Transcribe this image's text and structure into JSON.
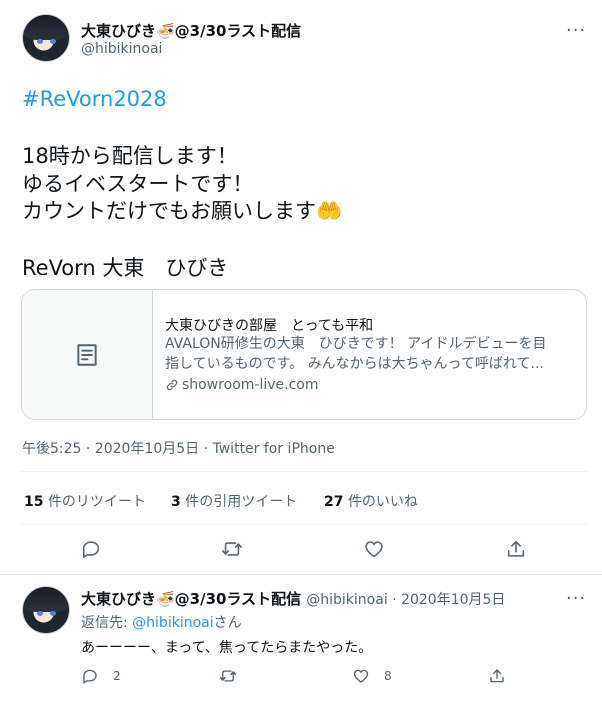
{
  "main_tweet": {
    "display_name": "大東ひびき🍜@3/30ラスト配信",
    "handle": "@hibikinoai",
    "more": "···",
    "hashtag": "#ReVorn2028",
    "lines": [
      "18時から配信します！",
      "ゆるイベスタートです！",
      "カウントだけでもお願いします🤲",
      "ReVorn 大東　ひびき"
    ],
    "card": {
      "title": "大東ひびきの部屋　とっても平和",
      "description_line1": "AVALON研修生の大東　ひびきです！ アイドルデビューを目",
      "description_line2": "指しているものです。 みんなからは大ちゃんって呼ばれて...",
      "domain": "showroom-live.com",
      "thumbnail_icon": "document-icon",
      "link_icon": "link-icon"
    },
    "meta": "午後5:25 · 2020年10月5日 · Twitter for iPhone",
    "stats": {
      "retweets_count": "15",
      "retweets_label": "件のリツイート",
      "quotes_count": "3",
      "quotes_label": "件の引用ツイート",
      "likes_count": "27",
      "likes_label": "件のいいね"
    },
    "actions": [
      "reply-icon",
      "retweet-icon",
      "like-icon",
      "share-icon"
    ]
  },
  "reply_tweet": {
    "display_name": "大東ひびき🍜@3/30ラスト配信",
    "handle_and_date": "@hibikinoai · 2020年10月5日",
    "more": "···",
    "reply_prefix": "返信先: ",
    "reply_to": "@hibikinoai",
    "reply_suffix": "さん",
    "text": "あーーーー、まって、焦ってたらまたやった。",
    "reply_count": "2",
    "retweet_count": "",
    "like_count": "8",
    "actions": [
      "reply-icon",
      "retweet-icon",
      "like-icon",
      "share-icon"
    ]
  },
  "colors": {
    "accent": "#1d9bf0",
    "text": "#0f1419",
    "secondary": "#536471",
    "border": "#cfd9de"
  }
}
